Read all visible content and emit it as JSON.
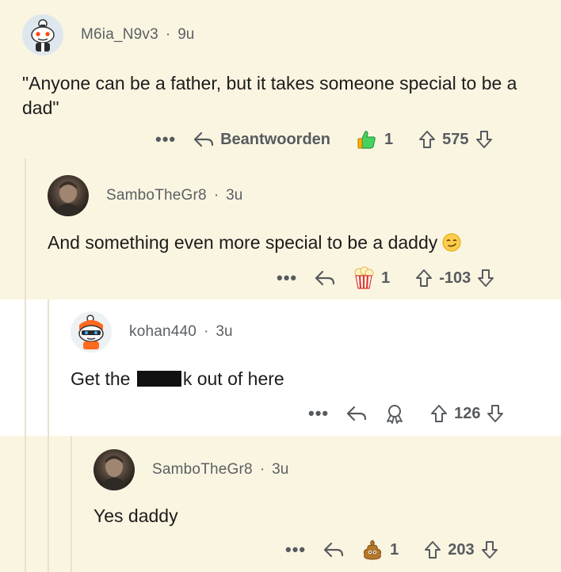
{
  "comments": [
    {
      "username": "M6ia_N9v3",
      "separator": "·",
      "age": "9u",
      "body": "\"Anyone can be a father, but it takes someone special to be a dad\"",
      "more": "•••",
      "reply_label": "Beantwoorden",
      "award_count": "1",
      "score": "575"
    },
    {
      "username": "SamboTheGr8",
      "separator": "·",
      "age": "3u",
      "body": "And something even more special to be a daddy",
      "more": "•••",
      "award_count": "1",
      "score": "-103"
    },
    {
      "username": "kohan440",
      "separator": "·",
      "age": "3u",
      "body_before": "Get the ",
      "body_after": "k out of here",
      "more": "•••",
      "score": "126"
    },
    {
      "username": "SamboTheGr8",
      "separator": "·",
      "age": "3u",
      "body": "Yes daddy",
      "more": "•••",
      "award_count": "1",
      "score": "203"
    }
  ],
  "colors": {
    "cream_background": "#faf5e1",
    "meta_text": "#5c6064",
    "icon_gray": "#575b5f"
  },
  "icons": [
    "snoo-avatar",
    "reply-arrow-icon",
    "thumbs-up-award-icon",
    "popcorn-award-icon",
    "helper-award-icon",
    "poop-award-icon",
    "upvote-icon",
    "downvote-icon",
    "smirk-emoji"
  ]
}
